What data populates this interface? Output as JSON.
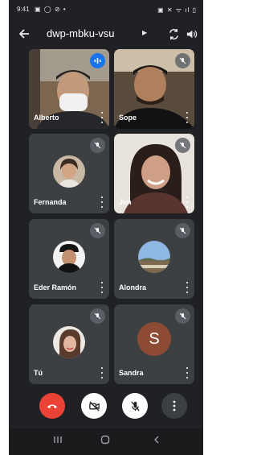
{
  "status_bar": {
    "time": "9:41",
    "left_icons": "▣ ◯ ⊘ •",
    "right_icons": "▣ ✕ ᯤ ıl ▯"
  },
  "header": {
    "meeting_code": "dwp-mbku-vsu",
    "caret": "▶"
  },
  "participants": [
    {
      "name": "Alberto",
      "status": "speaking"
    },
    {
      "name": "Sope",
      "status": "muted"
    },
    {
      "name": "Fernanda",
      "status": "muted"
    },
    {
      "name": "Jen",
      "status": "muted"
    },
    {
      "name": "Eder Ramón",
      "status": "muted"
    },
    {
      "name": "Alondra",
      "status": "muted"
    },
    {
      "name": "Tú",
      "status": "muted"
    },
    {
      "name": "Sandra",
      "status": "muted",
      "initial": "S"
    }
  ],
  "controls": [
    "end-call",
    "camera-off",
    "mic-off",
    "more-options"
  ],
  "colors": {
    "background": "#202124",
    "tile": "#3c4043",
    "end_call": "#ea4335",
    "speaking": "#1a73e8",
    "avatar_s": "#8d4b33"
  }
}
